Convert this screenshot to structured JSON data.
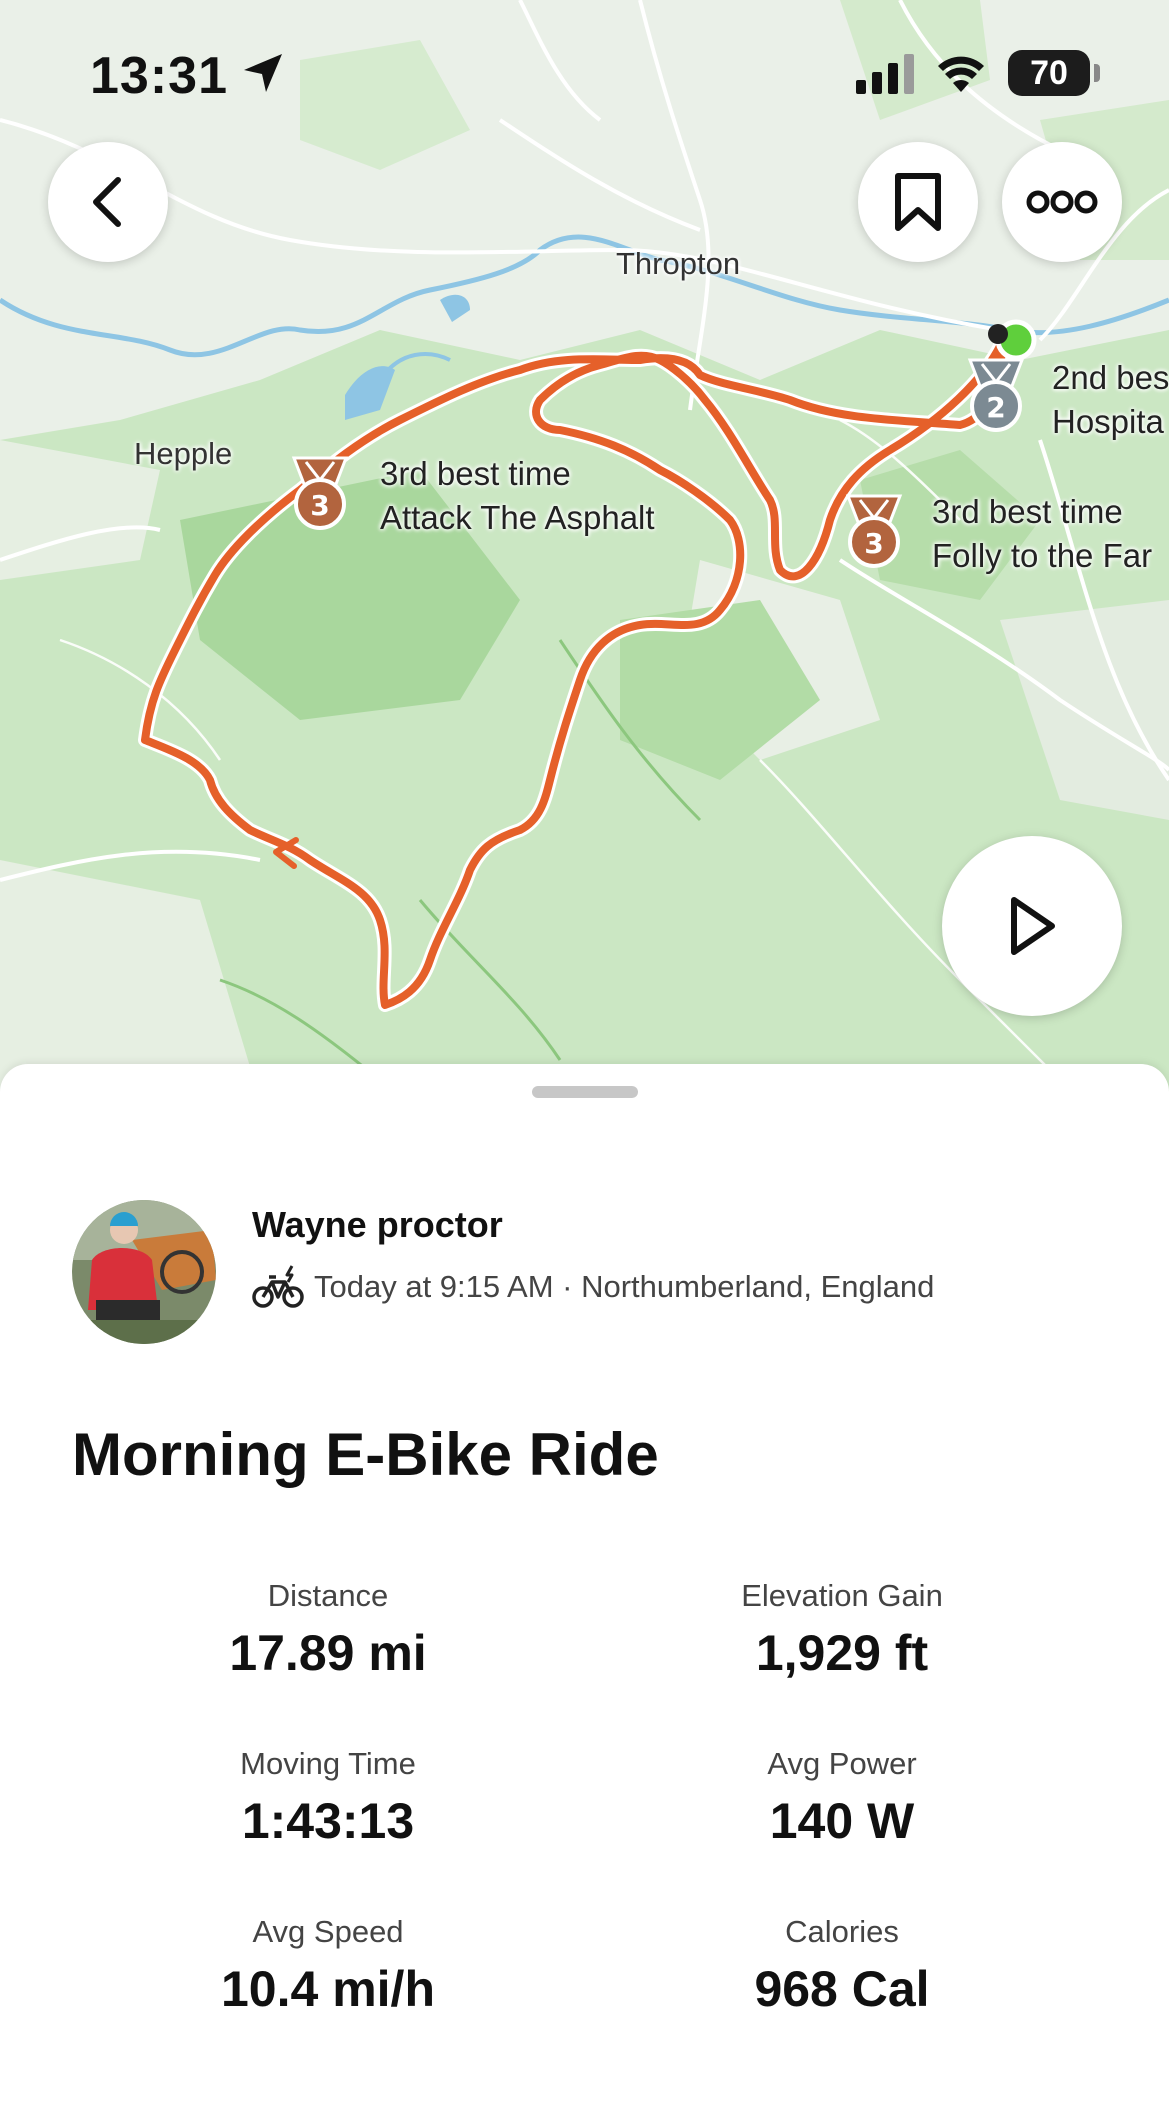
{
  "status_bar": {
    "time": "13:31",
    "battery": "70"
  },
  "map": {
    "places": [
      "Thropton",
      "Hepple"
    ],
    "segments": [
      {
        "rank": "2",
        "line1": "2nd bes",
        "line2": "Hospita"
      },
      {
        "rank": "3",
        "line1": "3rd best time",
        "line2": "Attack The Asphalt"
      },
      {
        "rank": "3",
        "line1": "3rd best time",
        "line2": "Folly to the Far"
      }
    ]
  },
  "activity": {
    "athlete": "Wayne proctor",
    "meta": "Today at 9:15 AM · Northumberland, England",
    "title": "Morning E-Bike Ride",
    "stats": [
      {
        "label": "Distance",
        "value": "17.89 mi"
      },
      {
        "label": "Elevation Gain",
        "value": "1,929 ft"
      },
      {
        "label": "Moving Time",
        "value": "1:43:13"
      },
      {
        "label": "Avg Power",
        "value": "140 W"
      },
      {
        "label": "Avg Speed",
        "value": "10.4 mi/h"
      },
      {
        "label": "Calories",
        "value": "968 Cal"
      }
    ]
  },
  "colors": {
    "route": "#e5602a",
    "medal_bronze": "#b2643e",
    "medal_silver": "#7c8a93",
    "start_dot": "#5fcf3c"
  }
}
